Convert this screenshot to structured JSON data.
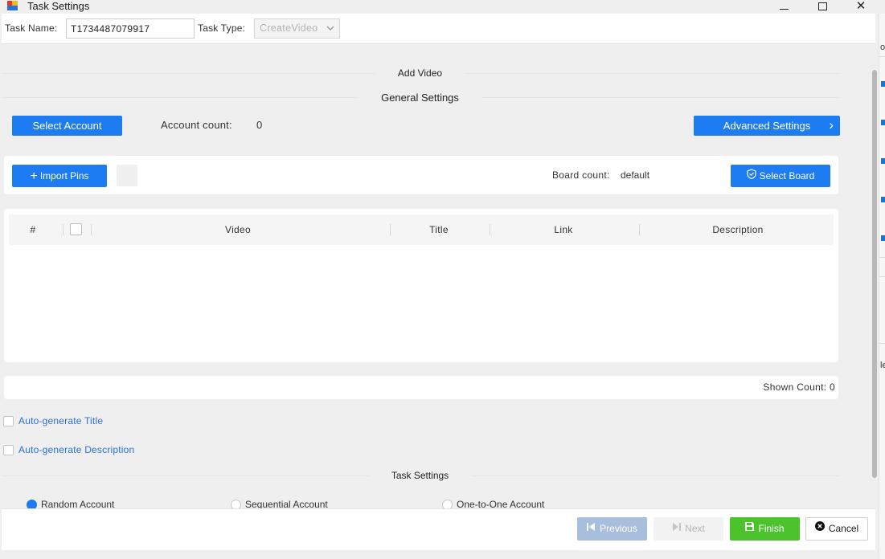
{
  "window": {
    "title": "Task Settings",
    "minimize_glyph": "",
    "maximize_glyph": "",
    "close_glyph": "✕"
  },
  "task": {
    "name_label": "Task Name:",
    "name_value": "T1734487079917",
    "type_label": "Task Type:",
    "type_value": "CreateVideo"
  },
  "sections": {
    "add_video": "Add Video",
    "general": "General Settings",
    "task_settings": "Task Settings"
  },
  "account": {
    "select_button": "Select Account",
    "count_label": "Account count:",
    "count_value": "0",
    "advanced_button": "Advanced Settings",
    "advanced_arrow": "›"
  },
  "pins": {
    "import_button": "Import Pins",
    "import_icon": "plus-icon",
    "board_count_label": "Board count:",
    "board_count_value": "default",
    "select_board_button": "Select Board",
    "select_board_icon": "shield-check-icon"
  },
  "table": {
    "columns": [
      "#",
      "Video",
      "Title",
      "Link",
      "Description"
    ],
    "rows": []
  },
  "shown": {
    "label": "Shown Count:",
    "value": "0"
  },
  "options": {
    "auto_title": "Auto-generate Title",
    "auto_description": "Auto-generate Description"
  },
  "account_mode": {
    "options": [
      "Random Account",
      "Sequential Account",
      "One-to-One Account"
    ],
    "selected": "Random Account"
  },
  "footer": {
    "previous": "Previous",
    "next": "Next",
    "finish": "Finish",
    "cancel": "Cancel"
  },
  "colors": {
    "primary": "#1e7cf2",
    "finish": "#4cc22d",
    "link_text": "#2a6fd6",
    "disabled_prev": "#a7bfdc"
  },
  "edge_chars": [
    "o",
    "le"
  ]
}
